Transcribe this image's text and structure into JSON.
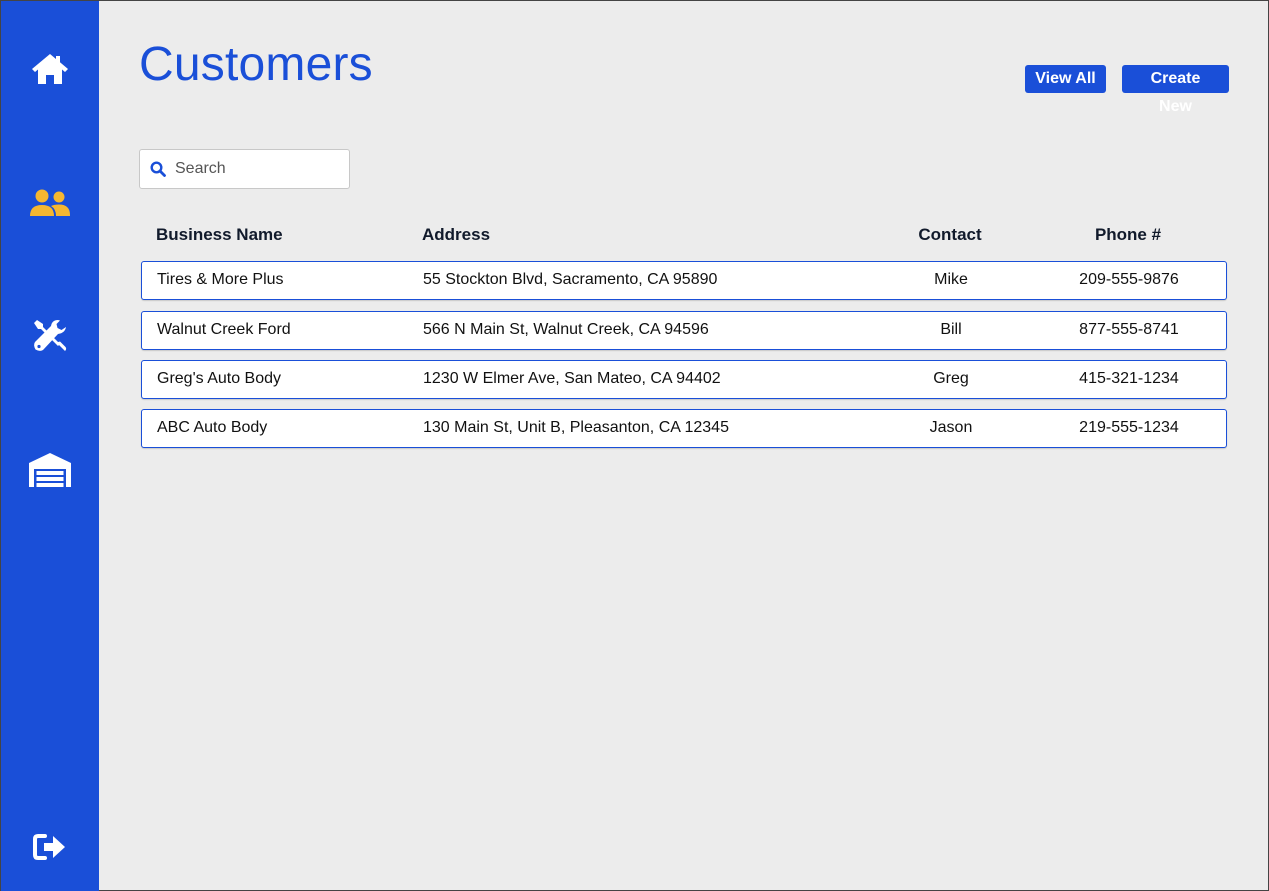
{
  "sidebar": {
    "items": [
      {
        "icon": "home-icon",
        "color": "#ffffff"
      },
      {
        "icon": "users-icon",
        "color": "#f5b731",
        "active": true
      },
      {
        "icon": "tools-icon",
        "color": "#ffffff"
      },
      {
        "icon": "garage-icon",
        "color": "#ffffff"
      },
      {
        "icon": "logout-icon",
        "color": "#ffffff"
      }
    ],
    "background": "#1a4fd8"
  },
  "header": {
    "title": "Customers",
    "view_all_label": "View All",
    "create_new_label": "Create New"
  },
  "search": {
    "placeholder": "Search",
    "value": ""
  },
  "table": {
    "columns": [
      "Business Name",
      "Address",
      "Contact",
      "Phone #"
    ],
    "rows": [
      {
        "name": "Tires & More Plus",
        "address": "55 Stockton Blvd, Sacramento, CA 95890",
        "contact": "Mike",
        "phone": "209-555-9876"
      },
      {
        "name": "Walnut Creek Ford",
        "address": "566 N Main St, Walnut Creek, CA 94596",
        "contact": "Bill",
        "phone": "877-555-8741"
      },
      {
        "name": "Greg's Auto Body",
        "address": "1230 W Elmer Ave, San Mateo, CA 94402",
        "contact": "Greg",
        "phone": "415-321-1234"
      },
      {
        "name": "ABC Auto Body",
        "address": "130 Main St, Unit B, Pleasanton, CA 12345",
        "contact": "Jason",
        "phone": "219-555-1234"
      }
    ]
  },
  "colors": {
    "accent": "#1a4fd8",
    "active_icon": "#f5b731",
    "background": "#ececec"
  }
}
